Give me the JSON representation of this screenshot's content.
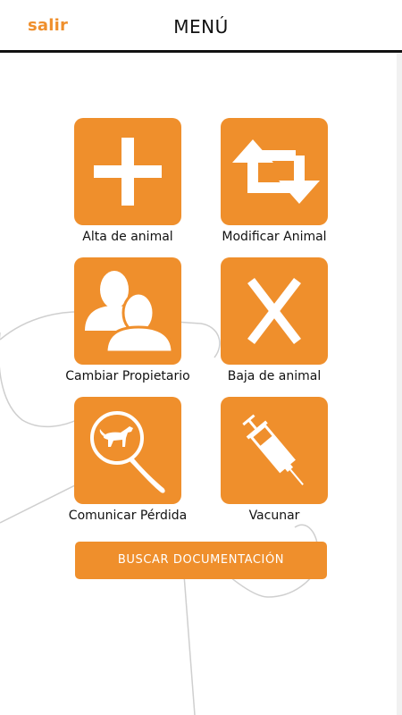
{
  "header": {
    "exit_label": "salir",
    "title": "MENÚ"
  },
  "menu": {
    "items": [
      {
        "label": "Alta de animal",
        "icon": "plus-icon"
      },
      {
        "label": "Modificar Animal",
        "icon": "refresh-arrows-icon"
      },
      {
        "label": "Cambiar Propietario",
        "icon": "two-people-icon"
      },
      {
        "label": "Baja de animal",
        "icon": "cross-x-icon"
      },
      {
        "label": "Comunicar Pérdida",
        "icon": "magnifier-dog-icon"
      },
      {
        "label": "Vacunar",
        "icon": "syringe-icon"
      }
    ]
  },
  "search_button": {
    "label": "BUSCAR DOCUMENTACIÓN"
  },
  "colors": {
    "accent": "#ef8f2c",
    "text": "#111111",
    "background": "#ffffff"
  }
}
